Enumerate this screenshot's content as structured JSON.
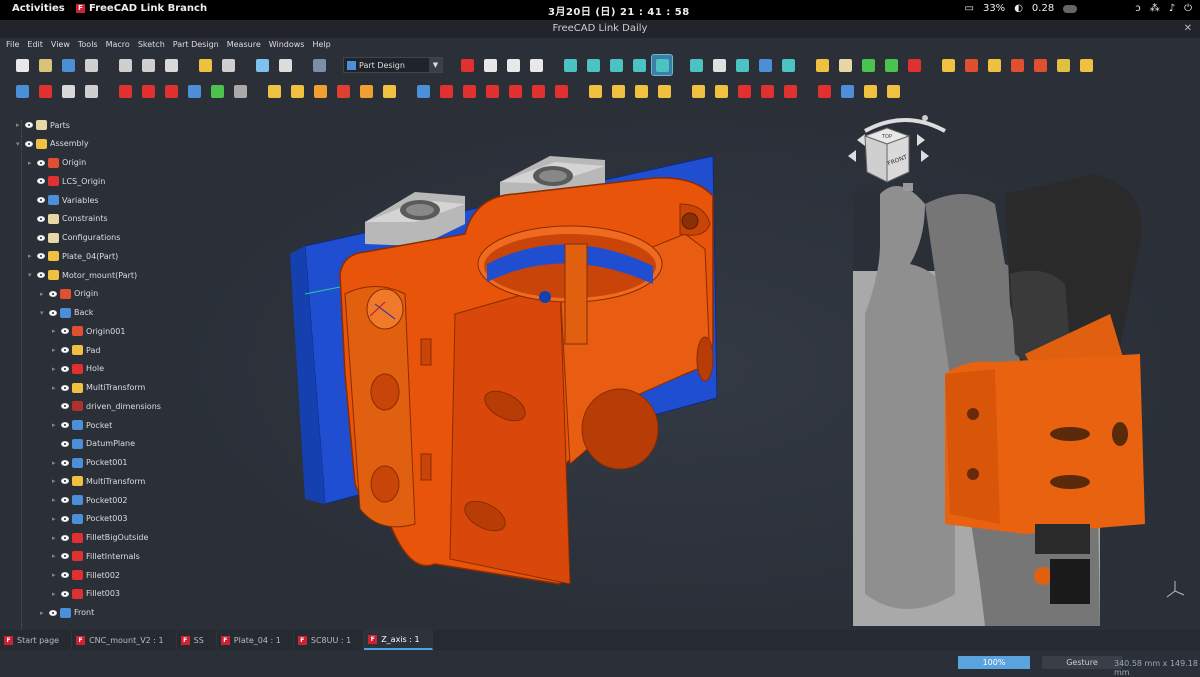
{
  "topbar": {
    "activities": "Activities",
    "app_name": "FreeCAD Link Branch",
    "clock": "3月20日 (日)  21 : 41 : 58",
    "battery": "33%",
    "load": "0.28"
  },
  "window": {
    "title": "FreeCAD Link Daily"
  },
  "menu": [
    "File",
    "Edit",
    "View",
    "Tools",
    "Macro",
    "Sketch",
    "Part Design",
    "Measure",
    "Windows",
    "Help"
  ],
  "toolbar": {
    "workbench": "Part Design",
    "toolbar1_icons": [
      {
        "name": "new-document-icon",
        "color": "#e8e8e8"
      },
      {
        "name": "open-document-icon",
        "color": "#d9c27a"
      },
      {
        "name": "save-icon",
        "color": "#4a8fd8"
      },
      {
        "name": "print-icon",
        "color": "#cfcfcf"
      },
      {
        "name": "cut-icon",
        "color": "#cfcfcf"
      },
      {
        "name": "copy-icon",
        "color": "#cfcfcf"
      },
      {
        "name": "paste-icon",
        "color": "#d9d9d9"
      },
      {
        "name": "undo-icon",
        "color": "#f0c040"
      },
      {
        "name": "redo-icon",
        "color": "#cfcfcf"
      },
      {
        "name": "refresh-check-icon",
        "color": "#7ec0ee"
      },
      {
        "name": "recompute-icon",
        "color": "#dcdcdc"
      },
      {
        "name": "whats-this-icon",
        "color": "#7a8fa8"
      }
    ],
    "toolbar1_right_icons": [
      {
        "name": "macro-record-icon",
        "color": "#e03030"
      },
      {
        "name": "macro-stop-icon",
        "color": "#e8e8e8"
      },
      {
        "name": "macro-edit-icon",
        "color": "#e8e8e8"
      },
      {
        "name": "macro-run-icon",
        "color": "#e8e8e8"
      },
      {
        "name": "fit-all-icon",
        "color": "#4cc3c3"
      },
      {
        "name": "draw-style-icon",
        "color": "#4cc3c3"
      },
      {
        "name": "bounding-box-icon",
        "color": "#4cc3c3"
      },
      {
        "name": "fit-selection-icon",
        "color": "#4cc3c3"
      },
      {
        "name": "select-box-zoom-icon",
        "color": "#4cc3c3"
      },
      {
        "name": "nav-back-icon",
        "color": "#4cc3c3"
      },
      {
        "name": "nav-forward-icon",
        "color": "#e0e0e0"
      },
      {
        "name": "nav-up-icon",
        "color": "#4cc3c3"
      },
      {
        "name": "view-measure-icon",
        "color": "#4a8fd8"
      },
      {
        "name": "measure-ruler-icon",
        "color": "#4cc3c3"
      },
      {
        "name": "part-create-icon",
        "color": "#f0c040"
      },
      {
        "name": "group-create-icon",
        "color": "#e8d7a6"
      },
      {
        "name": "link-create-icon",
        "color": "#4cc34c"
      },
      {
        "name": "link-sub-icon",
        "color": "#4cc34c"
      },
      {
        "name": "axis-icon",
        "color": "#e03030"
      },
      {
        "name": "assembly-add-part-icon",
        "color": "#f0c040"
      },
      {
        "name": "assembly-constraint-icon",
        "color": "#e05030"
      },
      {
        "name": "assembly-solve-icon",
        "color": "#f0c040"
      },
      {
        "name": "assembly-move-icon",
        "color": "#e05030"
      },
      {
        "name": "assembly-lcs-icon",
        "color": "#e05030"
      },
      {
        "name": "assembly-export-icon",
        "color": "#e0c040"
      },
      {
        "name": "assembly-bom-icon",
        "color": "#f0c040"
      }
    ],
    "toolbar2_icons": [
      {
        "name": "create-body-icon",
        "color": "#4a8fd8"
      },
      {
        "name": "create-sketch-icon",
        "color": "#e03030"
      },
      {
        "name": "validate-sketch-icon",
        "color": "#d8d8d8"
      },
      {
        "name": "shape-binder-icon",
        "color": "#cfcfcf"
      },
      {
        "name": "datum-point-icon",
        "color": "#e03030"
      },
      {
        "name": "datum-line-icon",
        "color": "#e03030"
      },
      {
        "name": "datum-lcs-icon",
        "color": "#e03030"
      },
      {
        "name": "datum-plane-icon",
        "color": "#4a8fd8"
      },
      {
        "name": "sub-shape-binder-icon",
        "color": "#4cc34c"
      },
      {
        "name": "clone-icon",
        "color": "#aaaaaa"
      },
      {
        "name": "pad-icon",
        "color": "#f0c040"
      },
      {
        "name": "revolution-icon",
        "color": "#f0c040"
      },
      {
        "name": "additive-loft-icon",
        "color": "#f0a030"
      },
      {
        "name": "additive-pipe-icon",
        "color": "#e04030"
      },
      {
        "name": "additive-helix-icon",
        "color": "#f0a030"
      },
      {
        "name": "additive-box-icon",
        "color": "#f0c040"
      },
      {
        "name": "pocket-icon",
        "color": "#4a8fd8"
      },
      {
        "name": "hole-icon",
        "color": "#e03030"
      },
      {
        "name": "groove-icon",
        "color": "#e03030"
      },
      {
        "name": "subtractive-loft-icon",
        "color": "#e03030"
      },
      {
        "name": "subtractive-pipe-icon",
        "color": "#e03030"
      },
      {
        "name": "subtractive-helix-icon",
        "color": "#e03030"
      },
      {
        "name": "subtractive-box-icon",
        "color": "#e03030"
      },
      {
        "name": "mirrored-icon",
        "color": "#f0c040"
      },
      {
        "name": "linear-pattern-icon",
        "color": "#f0c040"
      },
      {
        "name": "polar-pattern-icon",
        "color": "#f0c040"
      },
      {
        "name": "multitransform-icon",
        "color": "#f0c040"
      },
      {
        "name": "fillet-icon",
        "color": "#f0c040"
      },
      {
        "name": "chamfer-icon",
        "color": "#f0c040"
      },
      {
        "name": "draft-icon",
        "color": "#e03030"
      },
      {
        "name": "thickness-icon",
        "color": "#e03030"
      },
      {
        "name": "boolean-icon",
        "color": "#e03030"
      },
      {
        "name": "sprocket-icon",
        "color": "#e03030"
      },
      {
        "name": "involute-gear-icon",
        "color": "#4a8fd8"
      },
      {
        "name": "shaft-wizard-icon",
        "color": "#f0c040"
      },
      {
        "name": "hole-wizard-icon",
        "color": "#f0c040"
      }
    ]
  },
  "tree": [
    {
      "label": "Parts",
      "depth": 0,
      "icon": "folder",
      "color": "#e8d7a6",
      "toggle": "▸"
    },
    {
      "label": "Assembly",
      "depth": 0,
      "icon": "assembly",
      "color": "#f0c040",
      "toggle": "▾"
    },
    {
      "label": "Origin",
      "depth": 1,
      "icon": "origin",
      "color": "#e05030",
      "toggle": "▸"
    },
    {
      "label": "LCS_Origin",
      "depth": 1,
      "icon": "lcs",
      "color": "#e03030",
      "toggle": ""
    },
    {
      "label": "Variables",
      "depth": 1,
      "icon": "table",
      "color": "#4a8fd8",
      "toggle": ""
    },
    {
      "label": "Constraints",
      "depth": 1,
      "icon": "folder",
      "color": "#e8d7a6",
      "toggle": ""
    },
    {
      "label": "Configurations",
      "depth": 1,
      "icon": "folder",
      "color": "#e8d7a6",
      "toggle": ""
    },
    {
      "label": "Plate_04(Part)",
      "depth": 1,
      "icon": "link",
      "color": "#f0c040",
      "toggle": "▸"
    },
    {
      "label": "Motor_mount(Part)",
      "depth": 1,
      "icon": "part",
      "color": "#f0c040",
      "toggle": "▾"
    },
    {
      "label": "Origin",
      "depth": 2,
      "icon": "origin",
      "color": "#e05030",
      "toggle": "▸"
    },
    {
      "label": "Back",
      "depth": 2,
      "icon": "body",
      "color": "#4a8fd8",
      "toggle": "▾"
    },
    {
      "label": "Origin001",
      "depth": 3,
      "icon": "origin",
      "color": "#e05030",
      "toggle": "▸"
    },
    {
      "label": "Pad",
      "depth": 3,
      "icon": "pad",
      "color": "#f0c040",
      "toggle": "▸"
    },
    {
      "label": "Hole",
      "depth": 3,
      "icon": "hole",
      "color": "#e03030",
      "toggle": "▸"
    },
    {
      "label": "MultiTransform",
      "depth": 3,
      "icon": "multitransform",
      "color": "#f0c040",
      "toggle": "▸"
    },
    {
      "label": "driven_dimensions",
      "depth": 3,
      "icon": "sketch",
      "color": "#b03030",
      "toggle": ""
    },
    {
      "label": "Pocket",
      "depth": 3,
      "icon": "pocket",
      "color": "#4a8fd8",
      "toggle": "▸"
    },
    {
      "label": "DatumPlane",
      "depth": 3,
      "icon": "plane",
      "color": "#4a8fd8",
      "toggle": ""
    },
    {
      "label": "Pocket001",
      "depth": 3,
      "icon": "pocket",
      "color": "#4a8fd8",
      "toggle": "▸"
    },
    {
      "label": "MultiTransform",
      "depth": 3,
      "icon": "multitransform",
      "color": "#f0c040",
      "toggle": "▸"
    },
    {
      "label": "Pocket002",
      "depth": 3,
      "icon": "pocket",
      "color": "#4a8fd8",
      "toggle": "▸"
    },
    {
      "label": "Pocket003",
      "depth": 3,
      "icon": "pocket",
      "color": "#4a8fd8",
      "toggle": "▸"
    },
    {
      "label": "FilletBigOutside",
      "depth": 3,
      "icon": "fillet",
      "color": "#e03030",
      "toggle": "▸"
    },
    {
      "label": "FilletInternals",
      "depth": 3,
      "icon": "fillet",
      "color": "#e03030",
      "toggle": "▸"
    },
    {
      "label": "Fillet002",
      "depth": 3,
      "icon": "fillet",
      "color": "#e03030",
      "toggle": "▸"
    },
    {
      "label": "Fillet003",
      "depth": 3,
      "icon": "fillet",
      "color": "#e03030",
      "toggle": "▸"
    },
    {
      "label": "Front",
      "depth": 2,
      "icon": "body",
      "color": "#4a8fd8",
      "toggle": "▸"
    }
  ],
  "navcube": {
    "top": "TOP",
    "front": "FRONT"
  },
  "doc_tabs": [
    {
      "label": "Start page",
      "active": false
    },
    {
      "label": "CNC_mount_V2 : 1",
      "active": false
    },
    {
      "label": "SS",
      "active": false
    },
    {
      "label": "Plate_04 : 1",
      "active": false
    },
    {
      "label": "SC8UU : 1",
      "active": false
    },
    {
      "label": "Z_axis : 1",
      "active": true
    }
  ],
  "status": {
    "zoom": "100%",
    "navigation_style": "Gesture",
    "dimensions": "340.58 mm x 149.18 mm"
  },
  "colors": {
    "part_orange": "#e8540a",
    "plate_blue": "#1f4fd0",
    "nut_grey": "#b8b8b8",
    "accent": "#4aa3e0"
  }
}
